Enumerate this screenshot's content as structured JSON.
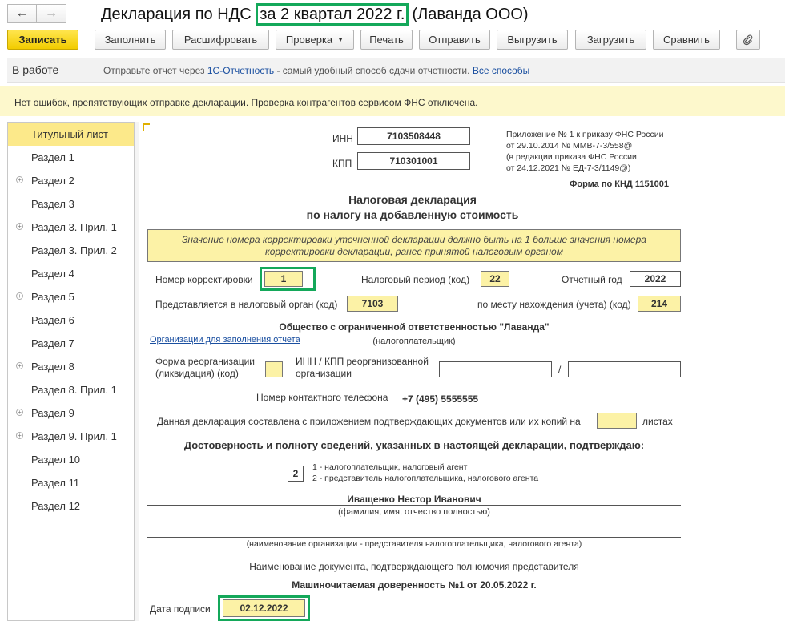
{
  "window": {
    "title_prefix": "Декларация по НДС",
    "title_period": "за 2 квартал 2022 г.",
    "title_org": "(Лаванда ООО)"
  },
  "toolbar": {
    "save": "Записать",
    "fill": "Заполнить",
    "decode": "Расшифровать",
    "check": "Проверка",
    "print": "Печать",
    "send": "Отправить",
    "export": "Выгрузить",
    "import": "Загрузить",
    "compare": "Сравнить"
  },
  "info": {
    "status": "В работе",
    "msg_before": "Отправьте отчет через",
    "msg_link": "1С-Отчетность",
    "msg_after": "- самый удобный способ сдачи отчетности.",
    "all_ways": "Все способы"
  },
  "warning": "Нет ошибок, препятствующих отправке декларации. Проверка контрагентов сервисом ФНС отключена.",
  "sidebar": {
    "items": [
      {
        "label": "Титульный лист",
        "expandable": false,
        "active": true
      },
      {
        "label": "Раздел 1",
        "expandable": false
      },
      {
        "label": "Раздел 2",
        "expandable": true
      },
      {
        "label": "Раздел 3",
        "expandable": false
      },
      {
        "label": "Раздел 3. Прил. 1",
        "expandable": true
      },
      {
        "label": "Раздел 3. Прил. 2",
        "expandable": false
      },
      {
        "label": "Раздел 4",
        "expandable": false
      },
      {
        "label": "Раздел 5",
        "expandable": true
      },
      {
        "label": "Раздел 6",
        "expandable": false
      },
      {
        "label": "Раздел 7",
        "expandable": false
      },
      {
        "label": "Раздел 8",
        "expandable": true
      },
      {
        "label": "Раздел 8. Прил. 1",
        "expandable": false
      },
      {
        "label": "Раздел 9",
        "expandable": true
      },
      {
        "label": "Раздел 9. Прил. 1",
        "expandable": true
      },
      {
        "label": "Раздел 10",
        "expandable": false
      },
      {
        "label": "Раздел 11",
        "expandable": false
      },
      {
        "label": "Раздел 12",
        "expandable": false
      }
    ]
  },
  "form": {
    "inn_label": "ИНН",
    "inn": "7103508448",
    "kpp_label": "КПП",
    "kpp": "710301001",
    "appendix_1": "Приложение № 1 к приказу ФНС России",
    "appendix_2": "от 29.10.2014 № ММВ-7-3/558@",
    "appendix_3": "(в редакции приказа ФНС России",
    "appendix_4": "от 24.12.2021 № ЕД-7-3/1149@)",
    "knd": "Форма по КНД 1151001",
    "title_1": "Налоговая декларация",
    "title_2": "по налогу на добавленную стоимость",
    "notice_1": "Значение номера корректировки уточненной декларации должно быть на 1 больше значения номера",
    "notice_2": "корректировки декларации, ранее принятой налоговым органом",
    "correction_label": "Номер корректировки",
    "correction": "1",
    "period_label": "Налоговый период (код)",
    "period": "22",
    "year_label": "Отчетный год",
    "year": "2022",
    "authority_label": "Представляется в налоговый орган (код)",
    "authority": "7103",
    "location_label": "по месту нахождения (учета) (код)",
    "location": "214",
    "org_name": "Общество с ограниченной ответственностью \"Лаванда\"",
    "org_fill_link": "Организации для заполнения отчета",
    "taxpayer_caption": "(налогоплательщик)",
    "reorg_label_1": "Форма реорганизации",
    "reorg_label_2": "(ликвидация) (код)",
    "reorg_inn_label_1": "ИНН / КПП реорганизованной",
    "reorg_inn_label_2": "организации",
    "slash": "/",
    "phone_label": "Номер контактного телефона",
    "phone": "+7 (495) 5555555",
    "attach_label": "Данная декларация составлена с приложением подтверждающих документов или их копий на",
    "sheets_label": "листах",
    "confirm_title": "Достоверность и полноту сведений, указанных в настоящей декларации, подтверждаю:",
    "signer_code": "2",
    "signer_opt_1": "1 - налогоплательщик, налоговый агент",
    "signer_opt_2": "2 - представитель налогоплательщика, налогового агента",
    "signer_name": "Иващенко Нестор Иванович",
    "fio_caption": "(фамилия, имя, отчество полностью)",
    "rep_org_caption": "(наименование организации - представителя налогоплательщика, налогового агента)",
    "doc_caption": "Наименование документа, подтверждающего полномочия представителя",
    "poa": "Машиночитаемая доверенность №1 от 20.05.2022 г.",
    "sign_date_label": "Дата подписи",
    "sign_date": "02.12.2022"
  }
}
